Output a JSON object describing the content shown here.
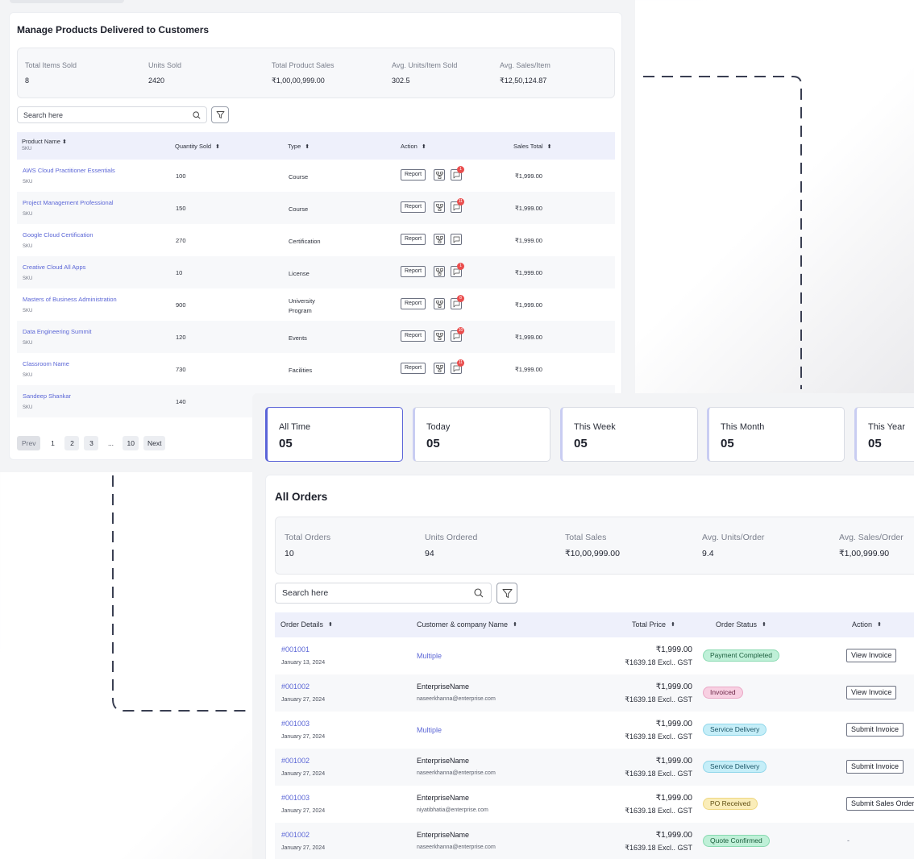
{
  "products": {
    "title": "Manage Products Delivered to Customers",
    "stats": [
      {
        "label": "Total Items Sold",
        "value": "8"
      },
      {
        "label": "Units Sold",
        "value": "2420"
      },
      {
        "label": "Total Product Sales",
        "value": "₹1,00,00,999.00"
      },
      {
        "label": "Avg. Units/Item Sold",
        "value": "302.5"
      },
      {
        "label": "Avg. Sales/Item",
        "value": "₹12,50,124.87"
      }
    ],
    "search_placeholder": "Search here",
    "columns": {
      "product": "Product Name",
      "product_sub": "SKU",
      "quantity": "Quantity Sold",
      "type": "Type",
      "action": "Action",
      "sales": "Sales Total"
    },
    "report_label": "Report",
    "rows": [
      {
        "name": "AWS Cloud Practitioner Essentials",
        "sku": "SKU",
        "qty": "100",
        "type": "Course",
        "type2": "",
        "badge": "1",
        "sales": "₹1,999.00"
      },
      {
        "name": "Project Management Professional",
        "sku": "SKU",
        "qty": "150",
        "type": "Course",
        "type2": "",
        "badge": "11",
        "sales": "₹1,999.00"
      },
      {
        "name": "Google Cloud Certification",
        "sku": "SKU",
        "qty": "270",
        "type": "Certification",
        "type2": "",
        "badge": "",
        "sales": "₹1,999.00"
      },
      {
        "name": "Creative Cloud All Apps",
        "sku": "SKU",
        "qty": "10",
        "type": "License",
        "type2": "",
        "badge": "1",
        "sales": "₹1,999.00"
      },
      {
        "name": "Masters of Business Administration",
        "sku": "SKU",
        "qty": "900",
        "type": "University",
        "type2": "Program",
        "badge": "8",
        "sales": "₹1,999.00"
      },
      {
        "name": "Data Engineering Summit",
        "sku": "SKU",
        "qty": "120",
        "type": "Events",
        "type2": "",
        "badge": "10",
        "sales": "₹1,999.00"
      },
      {
        "name": "Classroom Name",
        "sku": "SKU",
        "qty": "730",
        "type": "Facilities",
        "type2": "",
        "badge": "11",
        "sales": "₹1,999.00"
      },
      {
        "name": "Sandeep Shankar",
        "sku": "SKU",
        "qty": "140",
        "type": "",
        "type2": "",
        "badge": "",
        "sales": ""
      }
    ],
    "pager": {
      "prev": "Prev",
      "p1": "1",
      "p2": "2",
      "p3": "3",
      "ellipsis": "...",
      "p10": "10",
      "next": "Next"
    }
  },
  "periods": [
    {
      "label": "All Time",
      "value": "05"
    },
    {
      "label": "Today",
      "value": "05"
    },
    {
      "label": "This Week",
      "value": "05"
    },
    {
      "label": "This Month",
      "value": "05"
    },
    {
      "label": "This Year",
      "value": "05"
    }
  ],
  "orders": {
    "title": "All Orders",
    "stats": [
      {
        "label": "Total Orders",
        "value": "10"
      },
      {
        "label": "Units Ordered",
        "value": "94"
      },
      {
        "label": "Total Sales",
        "value": "₹10,00,999.00"
      },
      {
        "label": "Avg. Units/Order",
        "value": "9.4"
      },
      {
        "label": "Avg. Sales/Order",
        "value": "₹1,00,999.90"
      }
    ],
    "search_placeholder": "Search here",
    "columns": {
      "details": "Order Details",
      "customer": "Customer & company Name",
      "price": "Total Price",
      "status": "Order Status",
      "action": "Action"
    },
    "rows": [
      {
        "id": "#001001",
        "date": "January 13, 2024",
        "customer": "Multiple",
        "email": "",
        "price": "₹1,999.00",
        "price_excl": "₹1639.18 Excl.. GST",
        "status": "Payment Completed",
        "status_color": "#bff0d8",
        "action": "View Invoice"
      },
      {
        "id": "#001002",
        "date": "January 27, 2024",
        "customer": "EnterpriseName",
        "email": "naseerkhanna@enterprise.com",
        "price": "₹1,999.00",
        "price_excl": "₹1639.18 Excl.. GST",
        "status": "Invoiced",
        "status_color": "#f8d0e2",
        "action": "View Invoice"
      },
      {
        "id": "#001003",
        "date": "January 27, 2024",
        "customer": "Multiple",
        "email": "",
        "price": "₹1,999.00",
        "price_excl": "₹1639.18 Excl.. GST",
        "status": "Service Delivery",
        "status_color": "#c5eef8",
        "action": "Submit Invoice"
      },
      {
        "id": "#001002",
        "date": "January 27, 2024",
        "customer": "EnterpriseName",
        "email": "naseerkhanna@enterprise.com",
        "price": "₹1,999.00",
        "price_excl": "₹1639.18 Excl.. GST",
        "status": "Service Delivery",
        "status_color": "#c5eef8",
        "action": "Submit Invoice"
      },
      {
        "id": "#001003",
        "date": "January 27, 2024",
        "customer": "EnterpriseName",
        "email": "niyatibhatia@enterprise.com",
        "price": "₹1,999.00",
        "price_excl": "₹1639.18 Excl.. GST",
        "status": "PO Received",
        "status_color": "#faedb9",
        "action": "Submit Sales Order"
      },
      {
        "id": "#001002",
        "date": "January 27, 2024",
        "customer": "EnterpriseName",
        "email": "naseerkhanna@enterprise.com",
        "price": "₹1,999.00",
        "price_excl": "₹1639.18 Excl.. GST",
        "status": "Quote Confirmed",
        "status_color": "#bff0d8",
        "action": "-"
      }
    ]
  },
  "colors": {
    "accent": "#5b64d8",
    "link": "#5b66d6",
    "badge": "#ea4d4d",
    "header_bg": "#eef0fb"
  }
}
